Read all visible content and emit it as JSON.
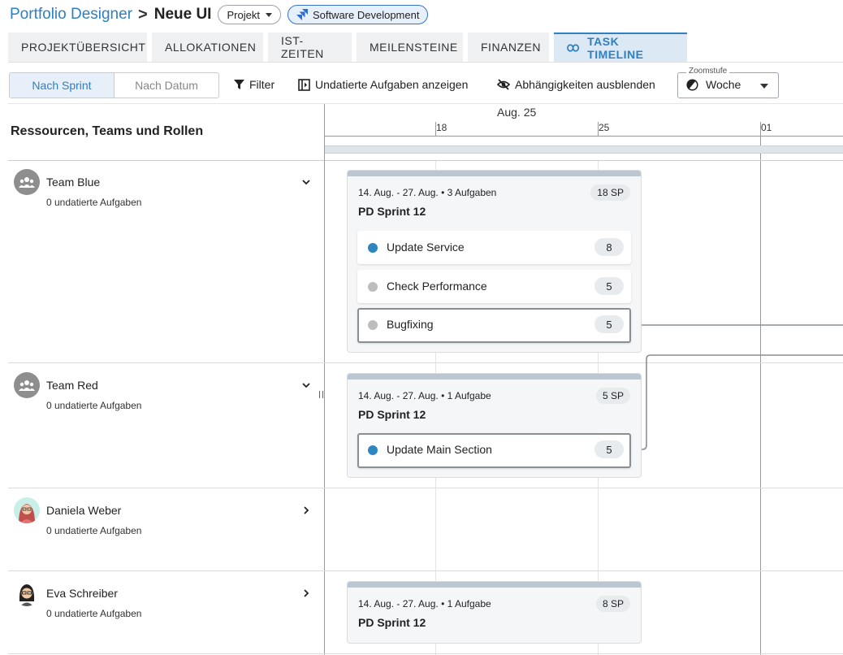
{
  "header": {
    "portfolio_link": "Portfolio Designer",
    "separator": ">",
    "page_title": "Neue UI",
    "project_chip": "Projekt",
    "integration_chip": "Software Development"
  },
  "tabs": [
    {
      "label": "PROJEKTÜBERSICHT",
      "active": false
    },
    {
      "label": "ALLOKATIONEN",
      "active": false
    },
    {
      "label": "IST-ZEITEN",
      "active": false
    },
    {
      "label": "MEILENSTEINE",
      "active": false
    },
    {
      "label": "FINANZEN",
      "active": false
    },
    {
      "label": "TASK TIMELINE",
      "active": true
    }
  ],
  "toolbar": {
    "view_sprint": "Nach Sprint",
    "view_date": "Nach Datum",
    "filter": "Filter",
    "show_undated": "Undatierte Aufgaben anzeigen",
    "hide_deps": "Abhängigkeiten ausblenden",
    "zoom_label": "Zoomstufe",
    "zoom_value": "Woche"
  },
  "timeline": {
    "left_header": "Ressourcen, Teams und Rollen",
    "month": "Aug. 25",
    "days": [
      "18",
      "25",
      "01"
    ]
  },
  "resources": [
    {
      "name": "Team Blue",
      "undated": "0 undatierte Aufgaben",
      "type": "team",
      "expanded": true
    },
    {
      "name": "Team Red",
      "undated": "0 undatierte Aufgaben",
      "type": "team",
      "expanded": true
    },
    {
      "name": "Daniela Weber",
      "undated": "0 undatierte Aufgaben",
      "type": "person",
      "expanded": false
    },
    {
      "name": "Eva Schreiber",
      "undated": "0 undatierte Aufgaben",
      "type": "person",
      "expanded": false
    }
  ],
  "sprints": [
    {
      "meta": "14. Aug. - 27. Aug. • 3 Aufgaben",
      "points": "18 SP",
      "title": "PD Sprint 12",
      "tasks": [
        {
          "label": "Update Service",
          "points": "8",
          "status_color": "#2e86c1",
          "selected": false
        },
        {
          "label": "Check Performance",
          "points": "5",
          "status_color": "#bdbdbd",
          "selected": false
        },
        {
          "label": "Bugfixing",
          "points": "5",
          "status_color": "#bdbdbd",
          "selected": true
        }
      ]
    },
    {
      "meta": "14. Aug. - 27. Aug. • 1 Aufgabe",
      "points": "5 SP",
      "title": "PD Sprint 12",
      "tasks": [
        {
          "label": "Update Main Section",
          "points": "5",
          "status_color": "#2e86c1",
          "selected": true
        }
      ]
    },
    {
      "meta": "14. Aug. - 27. Aug. • 1 Aufgabe",
      "points": "8 SP",
      "title": "PD Sprint 12",
      "tasks": []
    }
  ],
  "colors": {
    "accent": "#2f80c0",
    "in_progress": "#2e86c1",
    "todo": "#bdbdbd"
  }
}
